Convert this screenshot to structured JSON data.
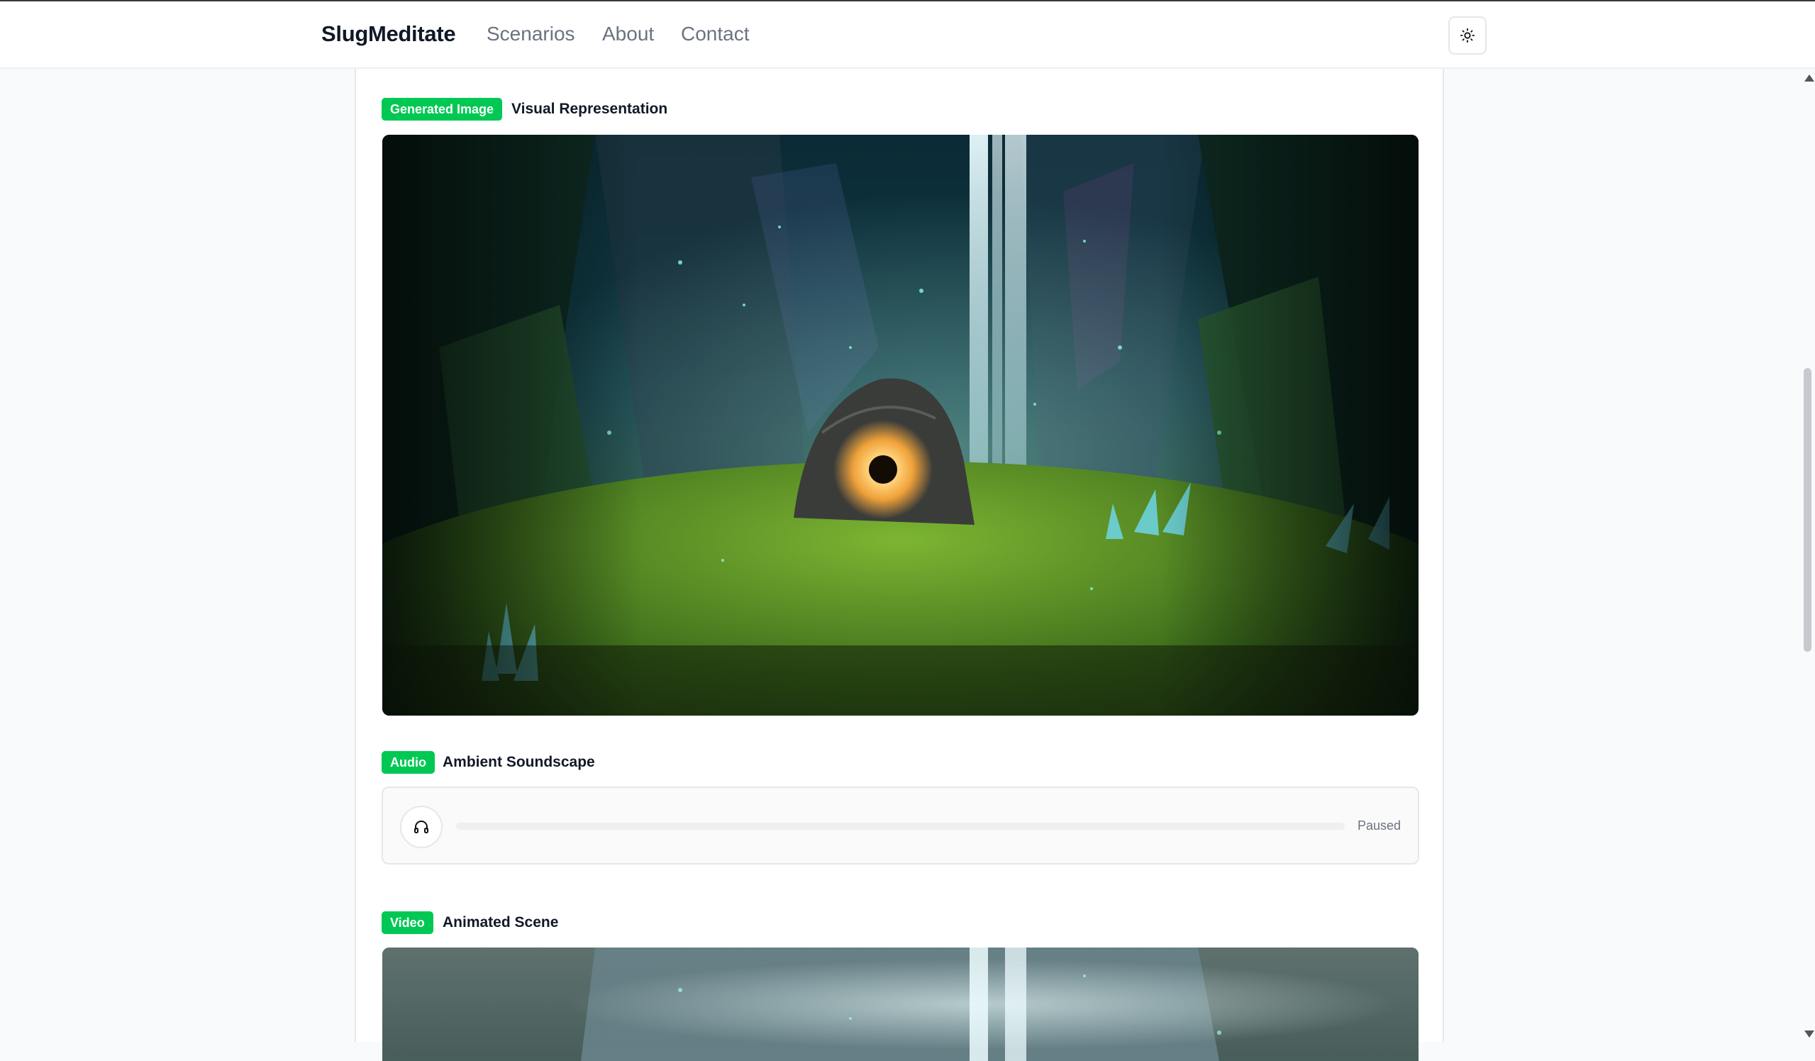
{
  "app": {
    "brand": "SlugMeditate"
  },
  "nav": {
    "items": [
      "Scenarios",
      "About",
      "Contact"
    ]
  },
  "theme_toggle": {
    "icon": "sun-icon"
  },
  "sections": {
    "image": {
      "badge": "Generated Image",
      "title": "Visual Representation",
      "alt": "Glowing stone portal in a mystical crystal forest with waterfall"
    },
    "audio": {
      "badge": "Audio",
      "title": "Ambient Soundscape",
      "status": "Paused",
      "progress": 0,
      "icon": "headphones-icon"
    },
    "video": {
      "badge": "Video",
      "title": "Animated Scene"
    }
  },
  "colors": {
    "accent": "#00c853",
    "text": "#111827",
    "muted": "#6b7280",
    "border": "#e5e7eb"
  }
}
